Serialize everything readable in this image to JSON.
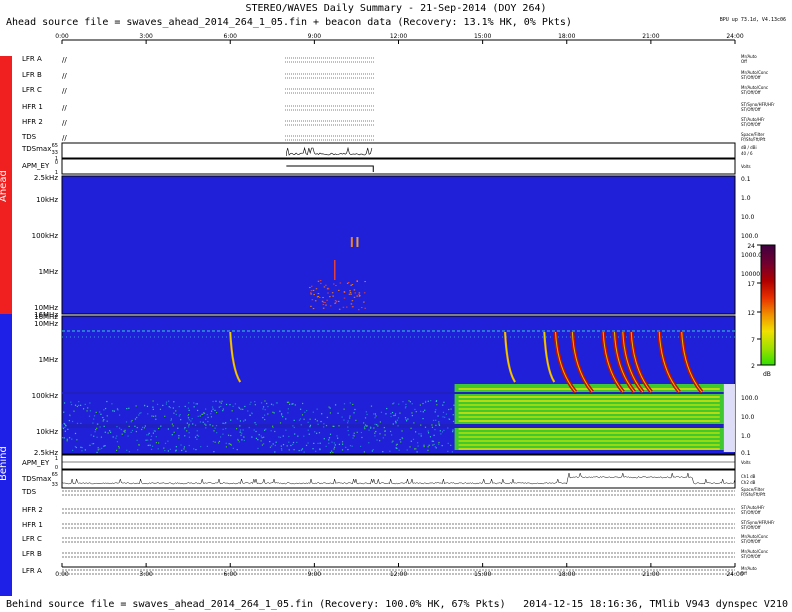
{
  "header": {
    "title": "STEREO/WAVES Daily Summary - 21-Sep-2014 (DOY 264)",
    "ahead_source": "Ahead source file = swaves_ahead_2014_264_1_05.fin + beacon data (Recovery: 13.1% HK,   0% Pkts)",
    "version_note": "BPU up 73.1d, V4.13c06"
  },
  "footer": {
    "behind_source": "Behind source file = swaves_ahead_2014_264_1_05.fin (Recovery: 100.0% HK, 67% Pkts)",
    "generated": "2014-12-15 18:16:36, TMlib V943 dynspec V210"
  },
  "sidebar": {
    "ahead_label": "Ahead",
    "behind_label": "Behind",
    "ahead_color": "#f02020",
    "behind_color": "#1e20e8"
  },
  "colors": {
    "spectrogram_background": "#2020d8",
    "colorbar": [
      "#30e000",
      "#a0e000",
      "#f0e000",
      "#f09000",
      "#e83000",
      "#b00000",
      "#700030",
      "#400040"
    ]
  },
  "chart_data": {
    "type": "heatmap",
    "time_axis": {
      "ticks": [
        "0:00",
        "3:00",
        "6:00",
        "9:00",
        "12:00",
        "15:00",
        "18:00",
        "21:00",
        "24:00"
      ],
      "range_hours": [
        0,
        24
      ]
    },
    "ahead": {
      "housekeeping_rows": [
        {
          "label": "LFR A",
          "right": "Mr/Auto\nOff"
        },
        {
          "label": "LFR B",
          "right": "Mr/Auto/Conc\nST/Off/Off"
        },
        {
          "label": "LFR C",
          "right": "Mr/Auto/Conc\nST/Off/Off"
        },
        {
          "label": "HFR 1",
          "right": "ST/Syno/HFR/HFr\nST/Off/Off"
        },
        {
          "label": "HFR 2",
          "right": "ST/Auto/HFr\nST/Off/Off"
        },
        {
          "label": "TDS",
          "right": "Space/Filter\nFf/Sfs/Fft/Pft"
        }
      ],
      "tdsmax": {
        "label": "TDSmax",
        "ticks": [
          "65",
          "33",
          "1"
        ],
        "right": "dB / dBi\n40 / 6"
      },
      "apm": {
        "label": "APM_EY",
        "ticks": [
          "0",
          "1"
        ],
        "right": "Volts"
      },
      "spectrogram": {
        "frequency_ticks_left": [
          "2.5kHz",
          "10kHz",
          "100kHz",
          "1MHz",
          "10MHz",
          "16MHz"
        ],
        "scale_ticks_right": [
          "0.1",
          "1.0",
          "10.0",
          "100.0",
          "1000.0",
          "10000.0"
        ],
        "data_window_hours": [
          8.0,
          11.1
        ]
      }
    },
    "behind": {
      "spectrogram": {
        "frequency_ticks_left": [
          "16MHz",
          "10MHz",
          "1MHz",
          "100kHz",
          "10kHz",
          "2.5kHz"
        ],
        "scale_ticks_right": [
          "10000.0",
          "1000.0",
          "100.0",
          "10.0",
          "1.0",
          "0.1"
        ],
        "type_iii_burst_hours": [
          6.0,
          15.8,
          17.2,
          17.6,
          18.2,
          19.3,
          19.7,
          20.0,
          20.3,
          21.3,
          22.1
        ],
        "data_gap_hours": [
          23.6,
          24.0
        ]
      },
      "apm": {
        "label": "APM_EY",
        "ticks": [
          "1",
          "0"
        ],
        "right": "Volts"
      },
      "tdsmax": {
        "label": "TDSmax",
        "ticks": [
          "65",
          "33"
        ],
        "right": "Ch1 dB / Ch2 dB"
      },
      "housekeeping_rows": [
        {
          "label": "TDS",
          "right": "Space/Filter\nFf/Sfs/Fft/Pft"
        },
        {
          "label": "HFR 2",
          "right": "ST/Auto/HFr\nST/Off/Off"
        },
        {
          "label": "HFR 1",
          "right": "ST/Syno/HFR/HFr\nST/Off/Off"
        },
        {
          "label": "LFR C",
          "right": "Mr/Auto/Conc\nST/Off/Off"
        },
        {
          "label": "LFR B",
          "right": "Mr/Auto/Conc\nST/Off/Off"
        },
        {
          "label": "LFR A",
          "right": "Mr/Auto\nOff"
        }
      ]
    },
    "colorbar": {
      "ticks": [
        "24",
        "17",
        "12",
        "7",
        "2"
      ],
      "unit": "dB",
      "range": [
        2,
        24
      ]
    }
  }
}
